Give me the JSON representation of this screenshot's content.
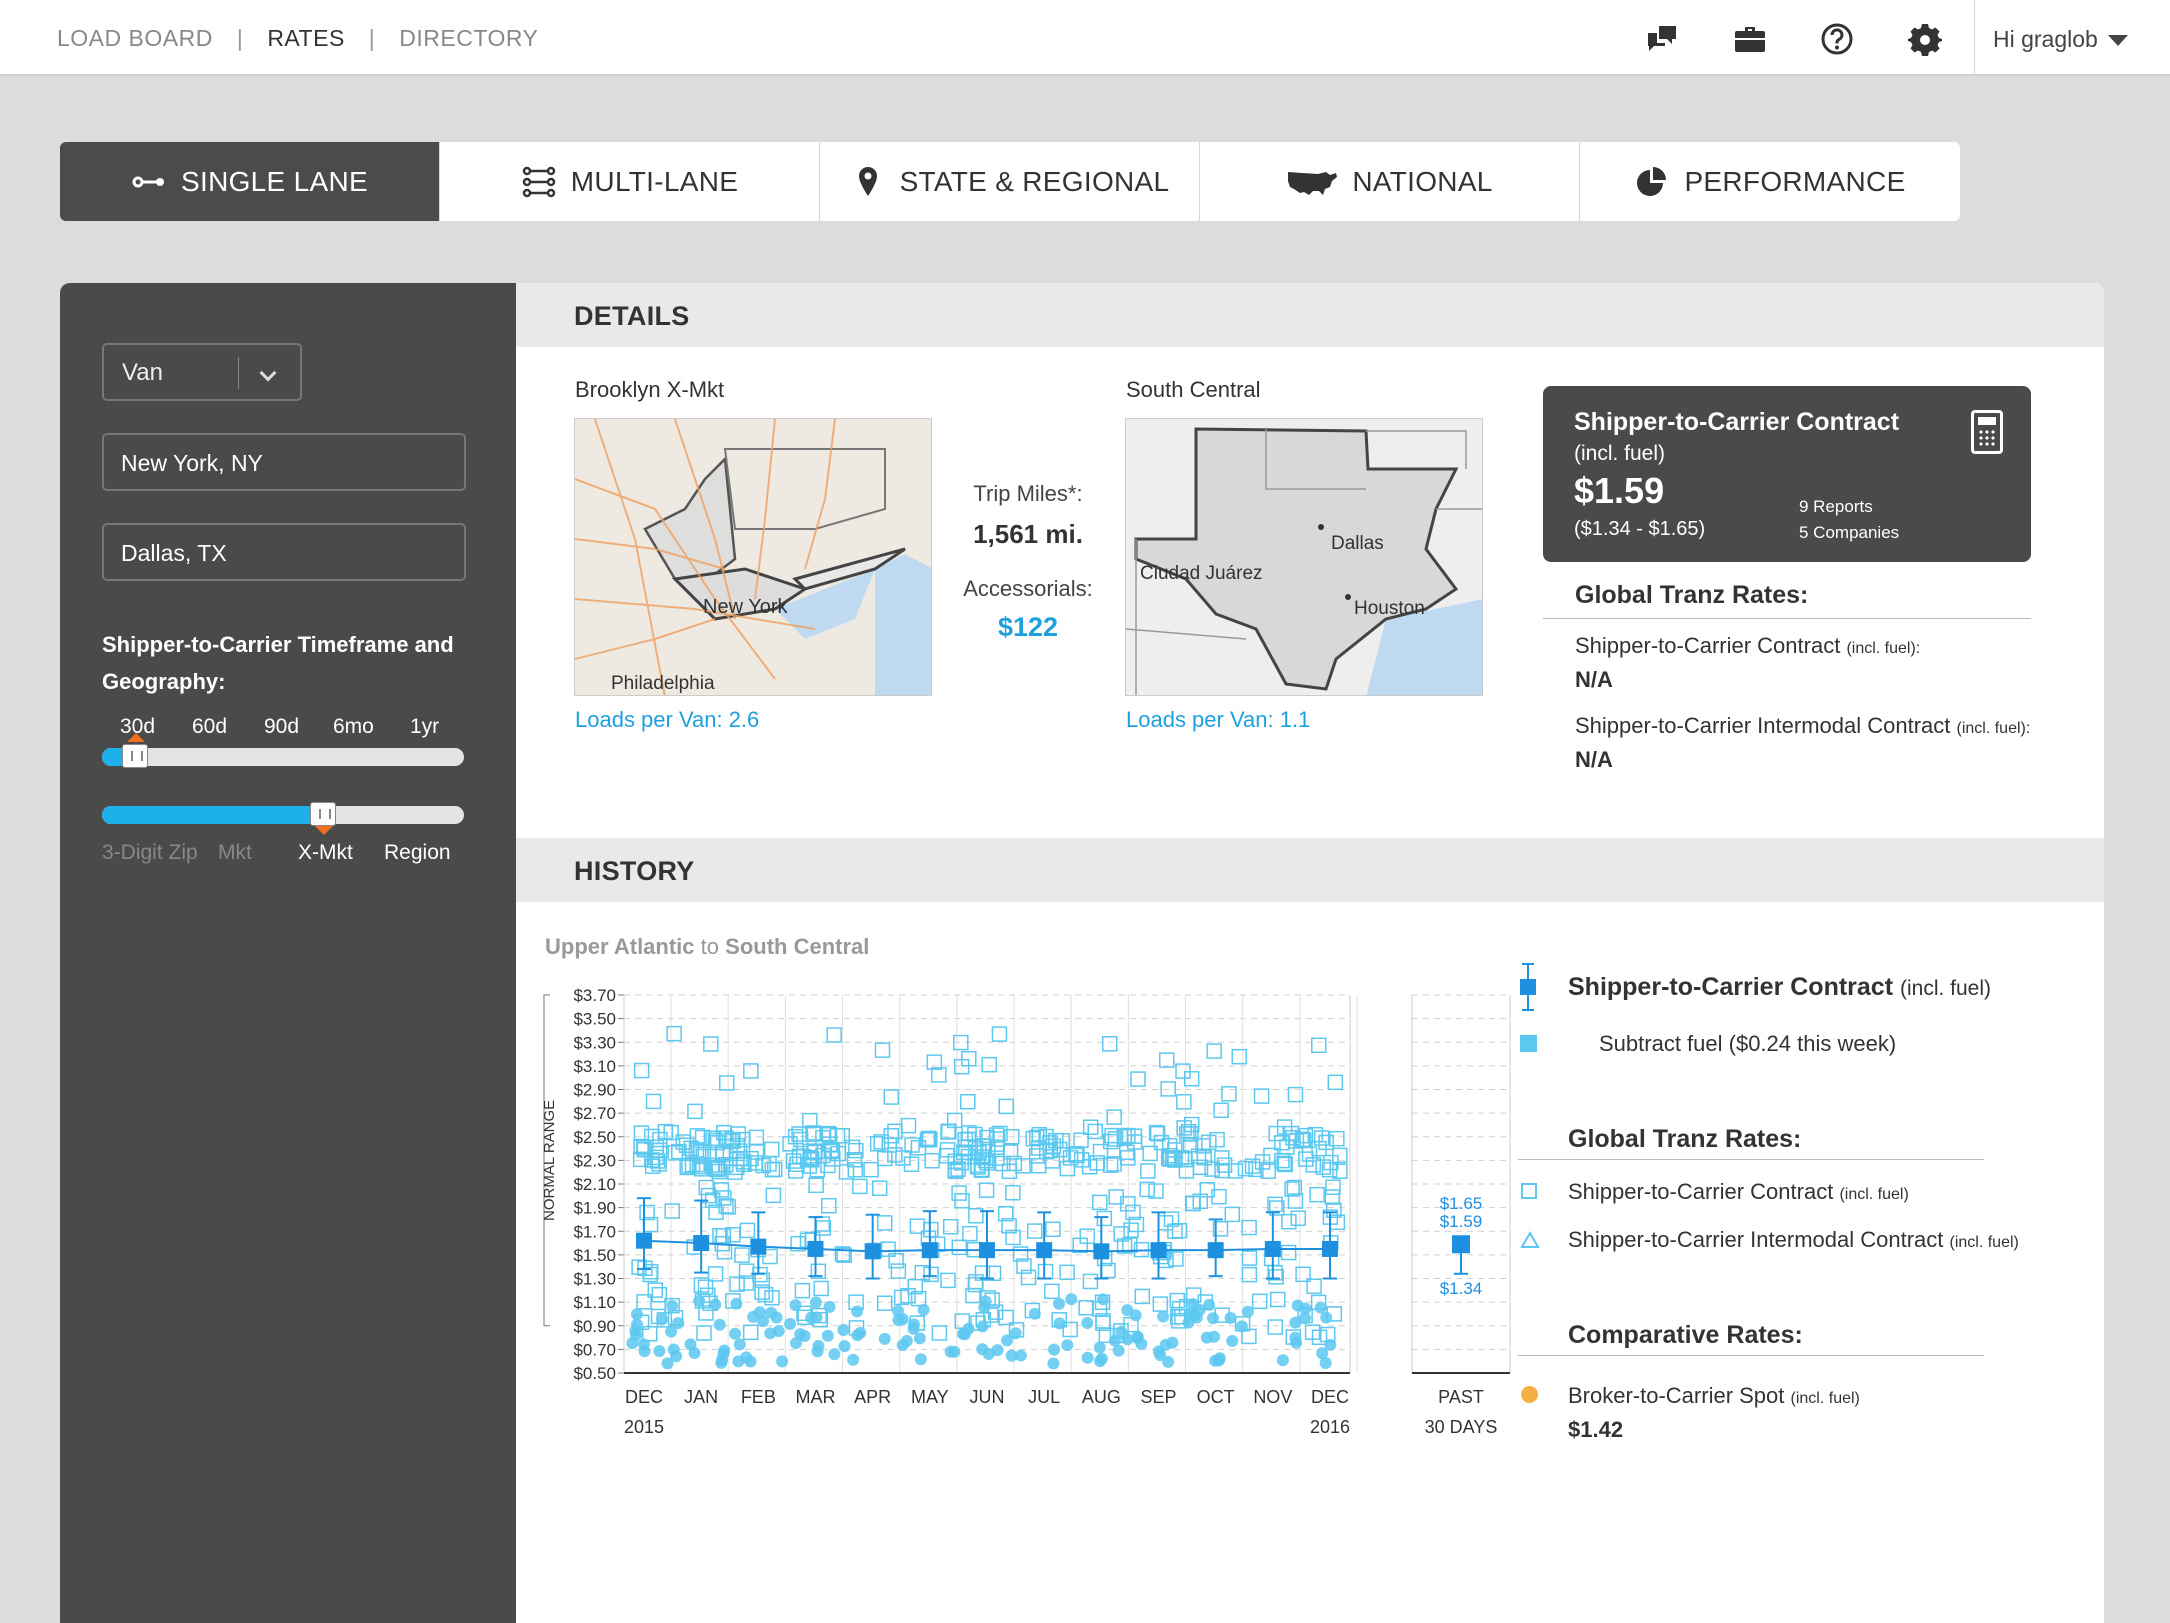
{
  "nav": {
    "links": [
      "LOAD BOARD",
      "RATES",
      "DIRECTORY"
    ],
    "separator": "|",
    "user": "Hi graglob"
  },
  "icons": {
    "chat": "chat-icon",
    "briefcase": "briefcase-icon",
    "help": "help-icon",
    "settings": "gear-icon"
  },
  "tabs": [
    {
      "label": "SINGLE LANE",
      "icon": "lane-icon",
      "active": true
    },
    {
      "label": "MULTI-LANE",
      "icon": "multi-lane-icon"
    },
    {
      "label": "STATE & REGIONAL",
      "icon": "map-pin-icon"
    },
    {
      "label": "NATIONAL",
      "icon": "usa-map-icon"
    },
    {
      "label": "PERFORMANCE",
      "icon": "pie-chart-icon"
    }
  ],
  "sidebar": {
    "equipment": "Van",
    "origin": "New York, NY",
    "destination": "Dallas, TX",
    "timeframe_label": "Shipper-to-Carrier Timeframe and Geography:",
    "timeframe_ticks": [
      "30d",
      "60d",
      "90d",
      "6mo",
      "1yr"
    ],
    "timeframe_selected": "30d",
    "geography_ticks": [
      "3-Digit Zip",
      "Mkt",
      "X-Mkt",
      "Region"
    ],
    "geography_selected": "X-Mkt"
  },
  "details": {
    "header": "DETAILS",
    "origin_market": "Brooklyn X-Mkt",
    "origin_map_labels": [
      "New York",
      "Philadelphia"
    ],
    "origin_loads": "Loads per Van:  2.6",
    "trip_miles_label": "Trip Miles*:",
    "trip_miles": "1,561 mi.",
    "accessorials_label": "Accessorials:",
    "accessorials": "$122",
    "dest_market": "South Central",
    "dest_map_labels": [
      "Dallas",
      "Ciudad Juárez",
      "Houston"
    ],
    "dest_loads": "Loads per Van:  1.1",
    "contract_card": {
      "title": "Shipper-to-Carrier Contract",
      "subtitle": "(incl. fuel)",
      "price": "$1.59",
      "range": "($1.34 - $1.65)",
      "reports": "9 Reports",
      "companies": "5 Companies"
    },
    "gt_title": "Global Tranz Rates:",
    "gt_rows": [
      {
        "label": "Shipper-to-Carrier Contract",
        "note": "(incl. fuel):",
        "value": "N/A"
      },
      {
        "label": "Shipper-to-Carrier Intermodal Contract",
        "note": "(incl. fuel):",
        "value": "N/A"
      }
    ]
  },
  "history": {
    "header": "HISTORY",
    "lane_from": "Upper Atlantic",
    "lane_to_word": "to",
    "lane_to": "South Central",
    "y_axis_title": "NORMAL RANGE",
    "past_label": [
      "PAST",
      "30 DAYS"
    ],
    "past_high": "$1.65",
    "past_mid": "$1.59",
    "past_low": "$1.34",
    "legend": {
      "contract": "Shipper-to-Carrier Contract",
      "contract_note": "(incl. fuel)",
      "subtract_fuel": "Subtract fuel ($0.24 this week)",
      "gt_title": "Global Tranz Rates:",
      "gt_contract": "Shipper-to-Carrier Contract",
      "gt_contract_note": "(incl. fuel)",
      "gt_intermodal": "Shipper-to-Carrier Intermodal Contract",
      "gt_intermodal_note": "(incl. fuel)",
      "comp_title": "Comparative Rates:",
      "spot_label": "Broker-to-Carrier Spot",
      "spot_note": "(incl. fuel)",
      "spot_value": "$1.42"
    },
    "colors": {
      "contract": "#1e90e0",
      "gt": "#5cc8f0",
      "spot": "#f5b043"
    }
  },
  "chart_data": {
    "type": "scatter",
    "y_ticks": [
      "$3.70",
      "$3.50",
      "$3.30",
      "$3.10",
      "$2.90",
      "$2.70",
      "$2.50",
      "$2.30",
      "$2.10",
      "$1.90",
      "$1.70",
      "$1.50",
      "$1.30",
      "$1.10",
      "$0.90",
      "$0.70",
      "$0.50"
    ],
    "ylim": [
      0.5,
      3.7
    ],
    "categories": [
      "DEC 2015",
      "JAN",
      "FEB",
      "MAR",
      "APR",
      "MAY",
      "JUN",
      "JUL",
      "AUG",
      "SEP",
      "OCT",
      "NOV",
      "DEC 2016"
    ],
    "category_labels": [
      "DEC",
      "JAN",
      "FEB",
      "MAR",
      "APR",
      "MAY",
      "JUN",
      "JUL",
      "AUG",
      "SEP",
      "OCT",
      "NOV",
      "DEC"
    ],
    "year_labels": [
      "2015",
      "2016"
    ],
    "series": [
      {
        "name": "Shipper-to-Carrier Contract (incl. fuel)",
        "values": [
          1.62,
          1.6,
          1.57,
          1.55,
          1.53,
          1.54,
          1.54,
          1.54,
          1.53,
          1.54,
          1.54,
          1.55,
          1.55
        ],
        "low": [
          1.38,
          1.35,
          1.34,
          1.32,
          1.3,
          1.32,
          1.3,
          1.3,
          1.3,
          1.3,
          1.32,
          1.3,
          1.3
        ],
        "high": [
          1.98,
          1.96,
          1.86,
          1.82,
          1.84,
          1.87,
          1.87,
          1.86,
          1.82,
          1.86,
          1.8,
          1.86,
          1.86
        ]
      }
    ],
    "past_30_days": {
      "value": 1.59,
      "low": 1.34,
      "high": 1.65
    }
  }
}
